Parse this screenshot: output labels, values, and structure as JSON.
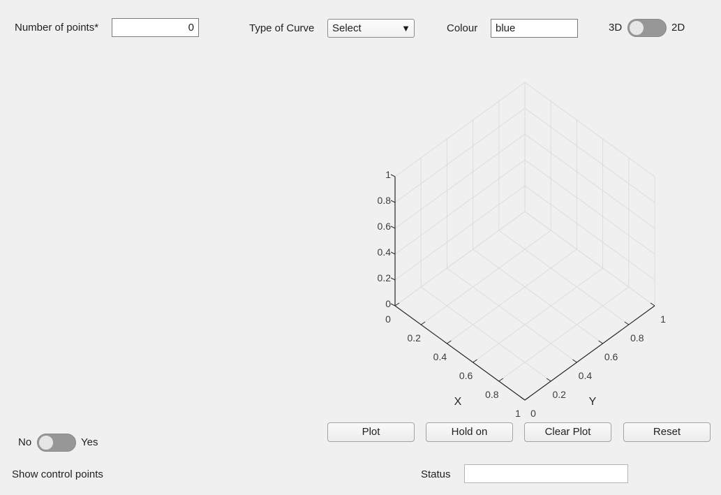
{
  "controls": {
    "num_points": {
      "label": "Number of points*",
      "value": "0"
    },
    "curve_type": {
      "label": "Type of Curve",
      "selected": "Select"
    },
    "colour": {
      "label": "Colour",
      "value": "blue"
    },
    "dimension_switch": {
      "left_label": "3D",
      "right_label": "2D",
      "state": "3D"
    }
  },
  "control_points": {
    "left_label": "No",
    "right_label": "Yes",
    "state": "No",
    "caption": "Show control points"
  },
  "buttons": {
    "plot": "Plot",
    "hold_on": "Hold on",
    "clear_plot": "Clear Plot",
    "reset": "Reset"
  },
  "status": {
    "label": "Status",
    "value": ""
  },
  "colors": {
    "background": "#f0f0f0",
    "axis_line": "#262626",
    "grid": "#dcdcdc",
    "tick_text": "#3c3c3c"
  },
  "chart_data": {
    "type": "scatter",
    "projection": "3d",
    "series": [],
    "xlabel": "X",
    "ylabel": "Y",
    "zlabel": "",
    "xlim": [
      0,
      1
    ],
    "ylim": [
      0,
      1
    ],
    "zlim": [
      0,
      1
    ],
    "xticks": [
      "0",
      "0.2",
      "0.4",
      "0.6",
      "0.8",
      "1"
    ],
    "yticks": [
      "0",
      "0.2",
      "0.4",
      "0.6",
      "0.8",
      "1"
    ],
    "zticks": [
      "0",
      "0.2",
      "0.4",
      "0.6",
      "0.8",
      "1"
    ],
    "grid": true
  }
}
